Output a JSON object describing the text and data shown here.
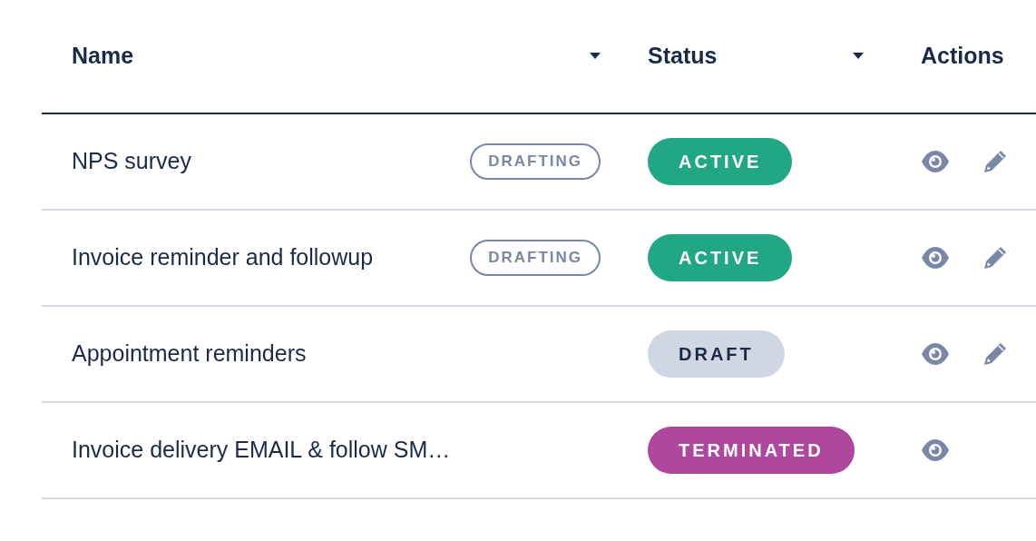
{
  "columns": [
    {
      "label": "Name",
      "sortable": true
    },
    {
      "label": "Status",
      "sortable": true
    },
    {
      "label": "Actions",
      "sortable": false
    }
  ],
  "rows": [
    {
      "name": "NPS survey",
      "tag": "DRAFTING",
      "status": {
        "kind": "active",
        "label": "ACTIVE"
      },
      "editable": true
    },
    {
      "name": "Invoice reminder and followup",
      "tag": "DRAFTING",
      "status": {
        "kind": "active",
        "label": "ACTIVE"
      },
      "editable": true
    },
    {
      "name": "Appointment reminders",
      "status": {
        "kind": "draft",
        "label": "DRAFT"
      },
      "editable": true
    },
    {
      "name": "Invoice delivery EMAIL & follow SM…",
      "status": {
        "kind": "terminated",
        "label": "TERMINATED"
      },
      "editable": false
    }
  ]
}
